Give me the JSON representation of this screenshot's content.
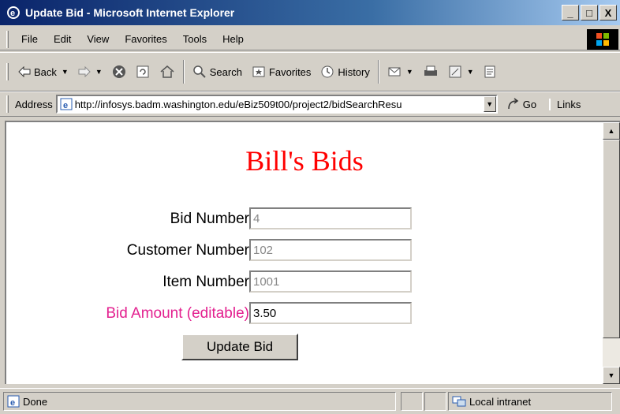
{
  "window": {
    "title": "Update Bid - Microsoft Internet Explorer",
    "min": "_",
    "max": "□",
    "close": "X"
  },
  "menu": [
    "File",
    "Edit",
    "View",
    "Favorites",
    "Tools",
    "Help"
  ],
  "toolbar": {
    "back": "Back",
    "search": "Search",
    "favorites": "Favorites",
    "history": "History"
  },
  "address": {
    "label": "Address",
    "url": "http://infosys.badm.washington.edu/eBiz509t00/project2/bidSearchResu",
    "go": "Go",
    "links": "Links"
  },
  "page": {
    "title": "Bill's Bids",
    "fields": [
      {
        "label": "Bid Number",
        "value": "4",
        "editable": false
      },
      {
        "label": "Customer Number",
        "value": "102",
        "editable": false
      },
      {
        "label": "Item Number",
        "value": "1001",
        "editable": false
      },
      {
        "label": "Bid Amount (editable)",
        "value": "3.50",
        "editable": true
      }
    ],
    "submit": "Update Bid"
  },
  "status": {
    "text": "Done",
    "zone": "Local intranet"
  },
  "colors": {
    "title_red": "#ff0000",
    "editable_label": "#e3208f",
    "readonly_text": "#888888"
  }
}
